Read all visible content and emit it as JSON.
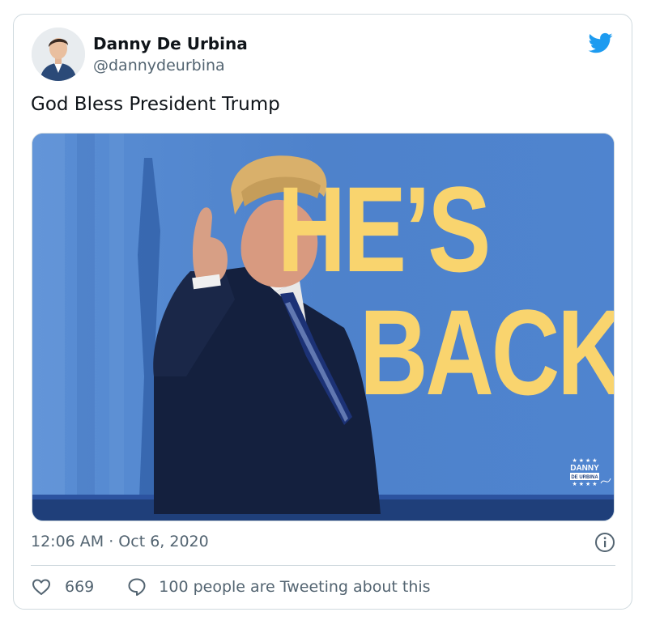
{
  "author": {
    "name": "Danny De Urbina",
    "handle": "@dannydeurbina"
  },
  "tweet": {
    "text": "God Bless President Trump",
    "timestamp": "12:06 AM · Oct 6, 2020"
  },
  "media": {
    "headline_line1": "HE’S",
    "headline_line2": "BACK.",
    "logo_line1": "DANNY",
    "logo_line2": "DE URBINA",
    "logo_stars": "★ ★ ★ ★"
  },
  "footer": {
    "likes": "669",
    "tweeting_text": "100 people are Tweeting about this"
  },
  "colors": {
    "twitter_blue": "#1d9bf0",
    "media_bg": "#4f82cc",
    "headline_yellow": "#f9d46e"
  },
  "icons": {
    "brand": "twitter-bird-icon",
    "info": "info-icon",
    "like": "heart-icon",
    "reply": "speech-bubble-icon"
  }
}
